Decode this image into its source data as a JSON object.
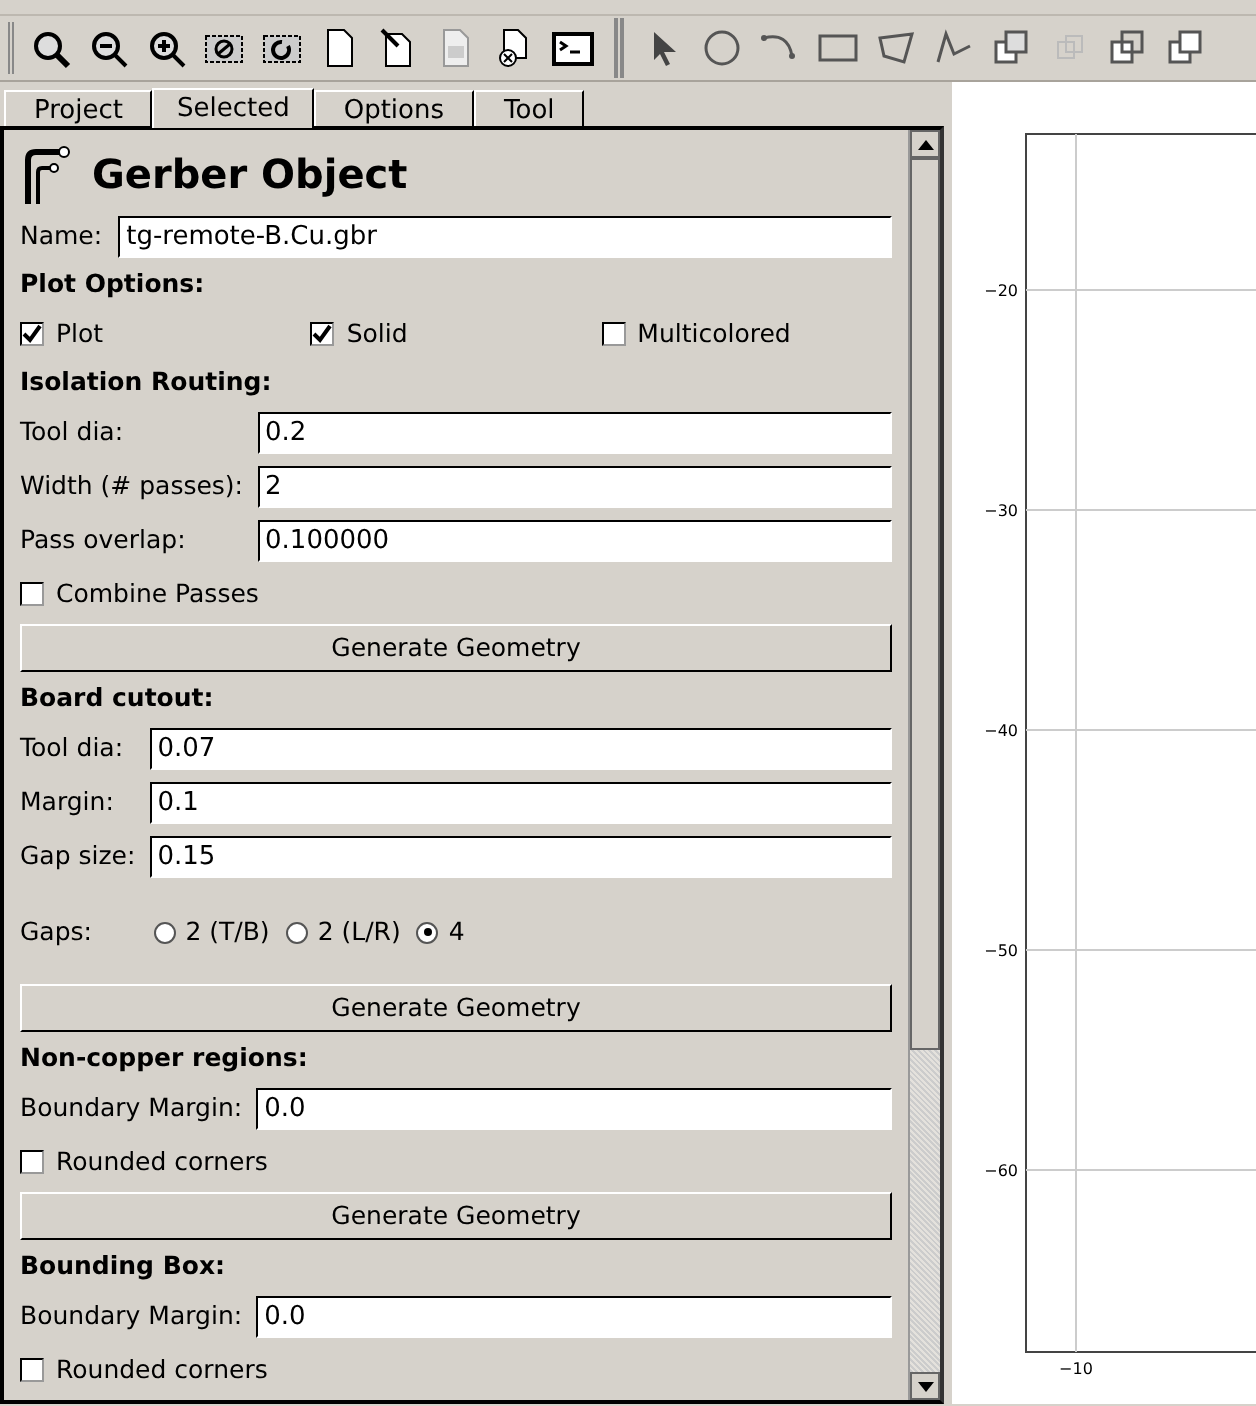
{
  "tabs": [
    {
      "label": "Project",
      "selected": false
    },
    {
      "label": "Selected",
      "selected": true
    },
    {
      "label": "Options",
      "selected": false
    },
    {
      "label": "Tool",
      "selected": false
    }
  ],
  "panel": {
    "title": "Gerber Object",
    "name_label": "Name:",
    "name_value": "tg-remote-B.Cu.gbr",
    "sections": [
      {
        "heading": "Plot Options:",
        "rows": [
          {
            "kind": "checks",
            "items": [
              {
                "label": "Plot",
                "checked": true
              },
              {
                "label": "Solid",
                "checked": true
              },
              {
                "label": "Multicolored",
                "checked": false
              }
            ]
          }
        ]
      },
      {
        "heading": "Isolation Routing:",
        "rows": [
          {
            "kind": "field",
            "label": "Tool dia:",
            "value": "0.2"
          },
          {
            "kind": "field",
            "label": "Width (# passes):",
            "value": "2"
          },
          {
            "kind": "field",
            "label": "Pass overlap:",
            "value": "0.100000"
          },
          {
            "kind": "checks",
            "items": [
              {
                "label": "Combine Passes",
                "checked": false
              }
            ]
          },
          {
            "kind": "button",
            "label": "Generate Geometry"
          }
        ]
      },
      {
        "heading": "Board cutout:",
        "rows": [
          {
            "kind": "field",
            "label": "Tool dia:",
            "value": "0.07"
          },
          {
            "kind": "field",
            "label": "Margin:",
            "value": "0.1"
          },
          {
            "kind": "field",
            "label": "Gap size:",
            "value": "0.15"
          },
          {
            "kind": "radios",
            "label": "Gaps:",
            "items": [
              {
                "label": "2 (T/B)",
                "selected": false
              },
              {
                "label": "2 (L/R)",
                "selected": false
              },
              {
                "label": "4",
                "selected": true
              }
            ]
          },
          {
            "kind": "button",
            "label": "Generate Geometry"
          }
        ]
      },
      {
        "heading": "Non-copper regions:",
        "rows": [
          {
            "kind": "field",
            "label": "Boundary Margin:",
            "value": "0.0"
          },
          {
            "kind": "checks",
            "items": [
              {
                "label": "Rounded corners",
                "checked": false
              }
            ]
          },
          {
            "kind": "button",
            "label": "Generate Geometry"
          }
        ]
      },
      {
        "heading": "Bounding Box:",
        "rows": [
          {
            "kind": "field",
            "label": "Boundary Margin:",
            "value": "0.0"
          },
          {
            "kind": "checks",
            "items": [
              {
                "label": "Rounded corners",
                "checked": false
              }
            ]
          }
        ]
      }
    ]
  },
  "plot": {
    "y_tick_labels": [
      "−20",
      "−30",
      "−40",
      "−50",
      "−60"
    ],
    "x_tick_labels": [
      "−10"
    ]
  }
}
